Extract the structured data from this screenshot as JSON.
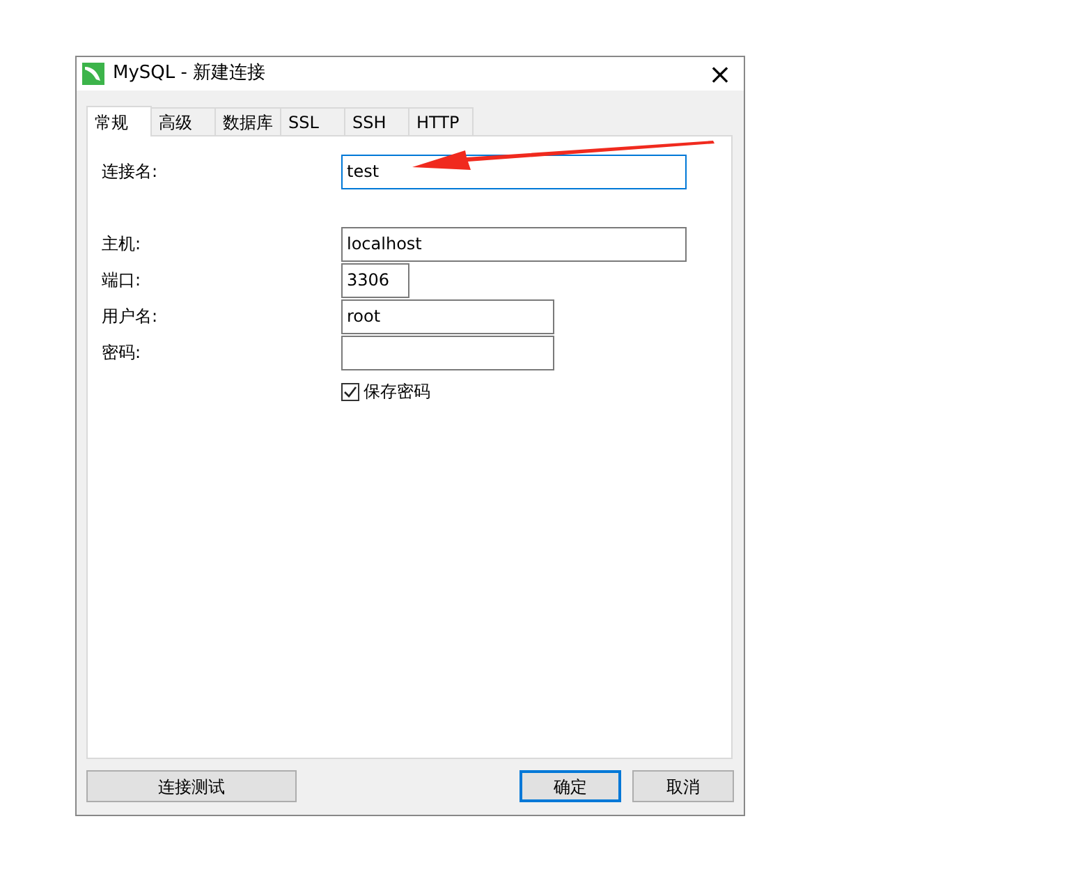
{
  "window": {
    "title": "MySQL - 新建连接",
    "close": "×"
  },
  "tabs": [
    {
      "label": "常规",
      "selected": true
    },
    {
      "label": "高级",
      "selected": false
    },
    {
      "label": "数据库",
      "selected": false
    },
    {
      "label": "SSL",
      "selected": false
    },
    {
      "label": "SSH",
      "selected": false
    },
    {
      "label": "HTTP",
      "selected": false
    }
  ],
  "field_groups": [
    [
      {
        "label": "连接名:",
        "value": "test",
        "kind": "wide",
        "focused": true
      }
    ],
    [
      {
        "label": "主机:",
        "value": "localhost",
        "kind": "wide",
        "focused": false
      },
      {
        "label": "端口:",
        "value": "3306",
        "kind": "narrow",
        "focused": false
      },
      {
        "label": "用户名:",
        "value": "root",
        "kind": "medium",
        "focused": false
      },
      {
        "label": "密码:",
        "kind": "medium",
        "focused": false
      }
    ]
  ],
  "save_password": {
    "label": "保存密码",
    "checked": true
  },
  "buttons": [
    {
      "label": "连接测试",
      "kind": "left",
      "default": false
    },
    {
      "label": "确定",
      "kind": "right",
      "default": true
    },
    {
      "label": "取消",
      "kind": "right",
      "default": false
    }
  ]
}
